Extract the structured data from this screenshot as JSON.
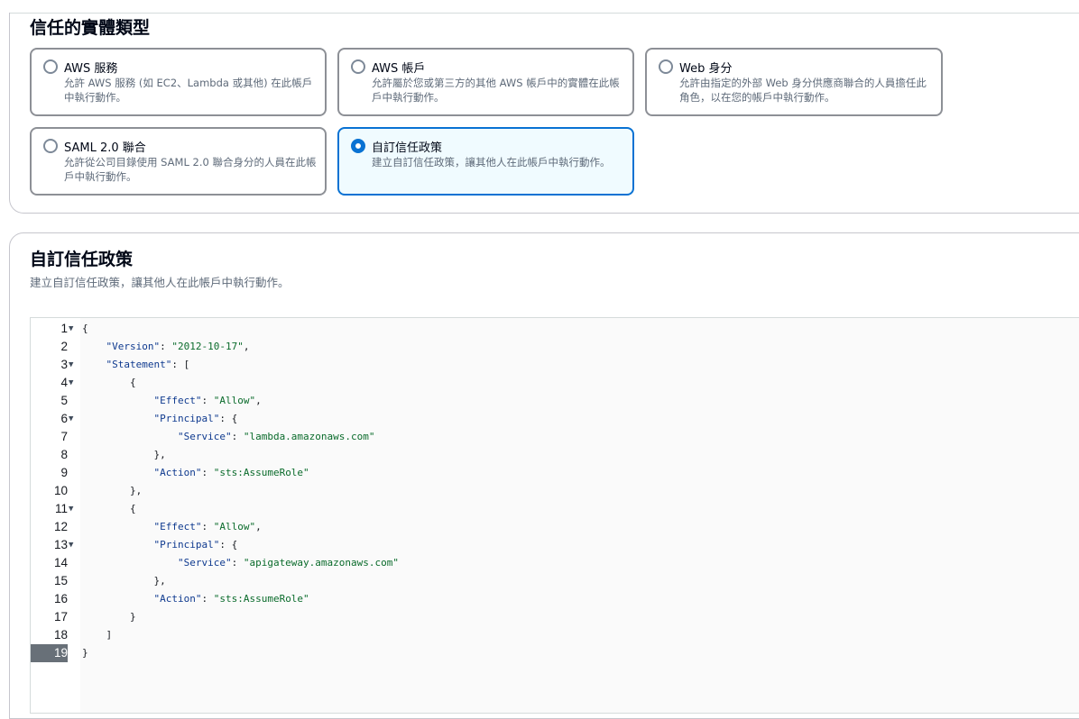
{
  "trusted_entity": {
    "heading": "信任的實體類型",
    "options": [
      {
        "title": "AWS 服務",
        "desc": "允許 AWS 服務 (如 EC2、Lambda 或其他) 在此帳戶中執行動作。",
        "selected": false
      },
      {
        "title": "AWS 帳戶",
        "desc": "允許屬於您或第三方的其他 AWS 帳戶中的實體在此帳戶中執行動作。",
        "selected": false
      },
      {
        "title": "Web 身分",
        "desc": "允許由指定的外部 Web 身分供應商聯合的人員擔任此角色，以在您的帳戶中執行動作。",
        "selected": false
      },
      {
        "title": "SAML 2.0 聯合",
        "desc": "允許從公司目錄使用 SAML 2.0 聯合身分的人員在此帳戶中執行動作。",
        "selected": false
      },
      {
        "title": "自訂信任政策",
        "desc": "建立自訂信任政策，讓其他人在此帳戶中執行動作。",
        "selected": true
      }
    ]
  },
  "custom_policy": {
    "heading": "自訂信任政策",
    "description": "建立自訂信任政策，讓其他人在此帳戶中執行動作。"
  },
  "editor": {
    "line_numbers": [
      "1",
      "2",
      "3",
      "4",
      "5",
      "6",
      "7",
      "8",
      "9",
      "10",
      "11",
      "12",
      "13",
      "14",
      "15",
      "16",
      "17",
      "18",
      "19"
    ],
    "lines": [
      "{",
      "    \"Version\": \"2012-10-17\",",
      "    \"Statement\": [",
      "        {",
      "            \"Effect\": \"Allow\",",
      "            \"Principal\": {",
      "                \"Service\": \"lambda.amazonaws.com\"",
      "            },",
      "            \"Action\": \"sts:AssumeRole\"",
      "        },",
      "        {",
      "            \"Effect\": \"Allow\",",
      "            \"Principal\": {",
      "                \"Service\": \"apigateway.amazonaws.com\"",
      "            },",
      "            \"Action\": \"sts:AssumeRole\"",
      "        }",
      "    ]",
      "}"
    ],
    "active_line": 19
  }
}
